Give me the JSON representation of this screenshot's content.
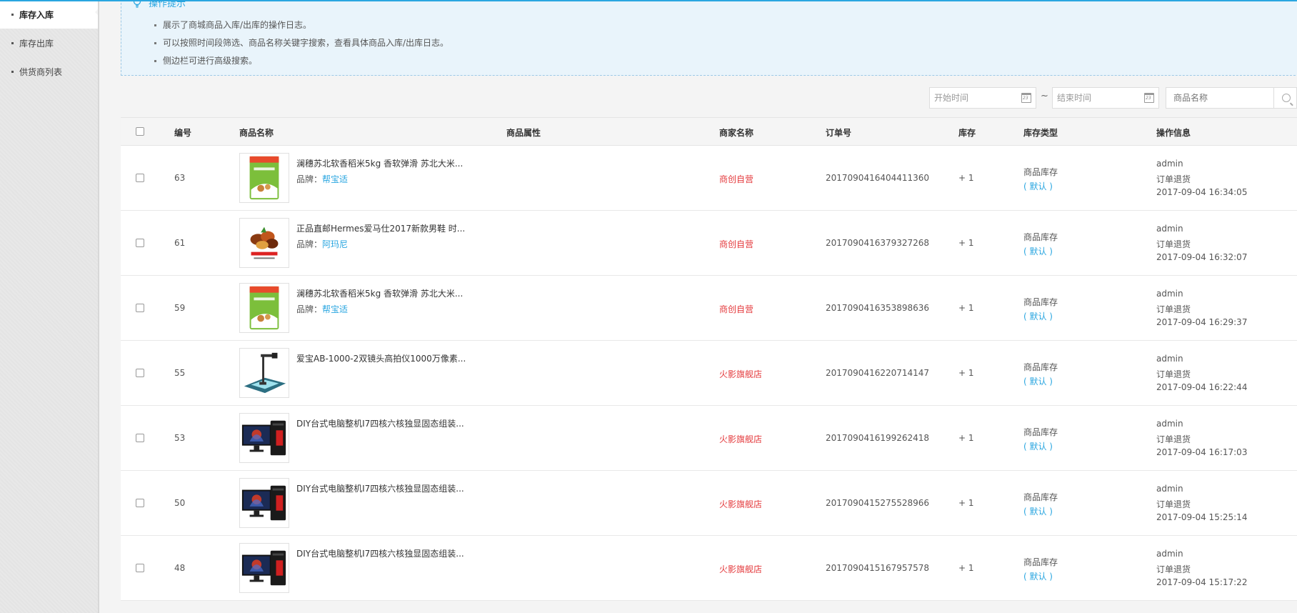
{
  "sidebar": {
    "items": [
      {
        "label": "库存入库",
        "active": true
      },
      {
        "label": "库存出库",
        "active": false
      },
      {
        "label": "供货商列表",
        "active": false
      }
    ]
  },
  "tips": {
    "title": "操作提示",
    "items": [
      "展示了商城商品入库/出库的操作日志。",
      "可以按照时间段筛选、商品名称关键字搜索，查看具体商品入库/出库日志。",
      "侧边栏可进行高级搜索。"
    ]
  },
  "filters": {
    "start_placeholder": "开始时间",
    "separator": "~",
    "end_placeholder": "结束时间",
    "search_placeholder": "商品名称",
    "calendar_icon_text": "23"
  },
  "table": {
    "columns": [
      "编号",
      "商品名称",
      "商品属性",
      "商家名称",
      "订单号",
      "库存",
      "库存类型",
      "操作信息"
    ],
    "brand_prefix": "品牌：",
    "rows": [
      {
        "id": "63",
        "name": "澜穗苏北软香稻米5kg 香软弹滑 苏北大米...",
        "brand": "帮宝适",
        "thumb": "rice",
        "merchant": "商创自营",
        "order": "2017090416404411360",
        "stock": "+ 1",
        "stock_type": "商品库存",
        "stock_note": "( 默认 )",
        "operator": "admin",
        "action": "订单退货",
        "time": "2017-09-04 16:34:05"
      },
      {
        "id": "61",
        "name": "正品直邮Hermes爱马仕2017新款男鞋 时...",
        "brand": "阿玛尼",
        "thumb": "food",
        "merchant": "商创自营",
        "order": "2017090416379327268",
        "stock": "+ 1",
        "stock_type": "商品库存",
        "stock_note": "( 默认 )",
        "operator": "admin",
        "action": "订单退货",
        "time": "2017-09-04 16:32:07"
      },
      {
        "id": "59",
        "name": "澜穗苏北软香稻米5kg 香软弹滑 苏北大米...",
        "brand": "帮宝适",
        "thumb": "rice",
        "merchant": "商创自营",
        "order": "2017090416353898636",
        "stock": "+ 1",
        "stock_type": "商品库存",
        "stock_note": "( 默认 )",
        "operator": "admin",
        "action": "订单退货",
        "time": "2017-09-04 16:29:37"
      },
      {
        "id": "55",
        "name": "爱宝AB-1000-2双镜头高拍仪1000万像素...",
        "brand": "",
        "thumb": "scanner",
        "merchant": "火影旗舰店",
        "order": "2017090416220714147",
        "stock": "+ 1",
        "stock_type": "商品库存",
        "stock_note": "( 默认 )",
        "operator": "admin",
        "action": "订单退货",
        "time": "2017-09-04 16:22:44"
      },
      {
        "id": "53",
        "name": "DIY台式电脑整机I7四核六核独显固态组装...",
        "brand": "",
        "thumb": "pc",
        "merchant": "火影旗舰店",
        "order": "2017090416199262418",
        "stock": "+ 1",
        "stock_type": "商品库存",
        "stock_note": "( 默认 )",
        "operator": "admin",
        "action": "订单退货",
        "time": "2017-09-04 16:17:03"
      },
      {
        "id": "50",
        "name": "DIY台式电脑整机I7四核六核独显固态组装...",
        "brand": "",
        "thumb": "pc",
        "merchant": "火影旗舰店",
        "order": "2017090415275528966",
        "stock": "+ 1",
        "stock_type": "商品库存",
        "stock_note": "( 默认 )",
        "operator": "admin",
        "action": "订单退货",
        "time": "2017-09-04 15:25:14"
      },
      {
        "id": "48",
        "name": "DIY台式电脑整机I7四核六核独显固态组装...",
        "brand": "",
        "thumb": "pc",
        "merchant": "火影旗舰店",
        "order": "2017090415167957578",
        "stock": "+ 1",
        "stock_type": "商品库存",
        "stock_note": "( 默认 )",
        "operator": "admin",
        "action": "订单退货",
        "time": "2017-09-04 15:17:22"
      }
    ]
  },
  "colors": {
    "accent": "#2aa6e0",
    "merchant": "#e4393c",
    "tips_bg": "#e9f4fb"
  }
}
